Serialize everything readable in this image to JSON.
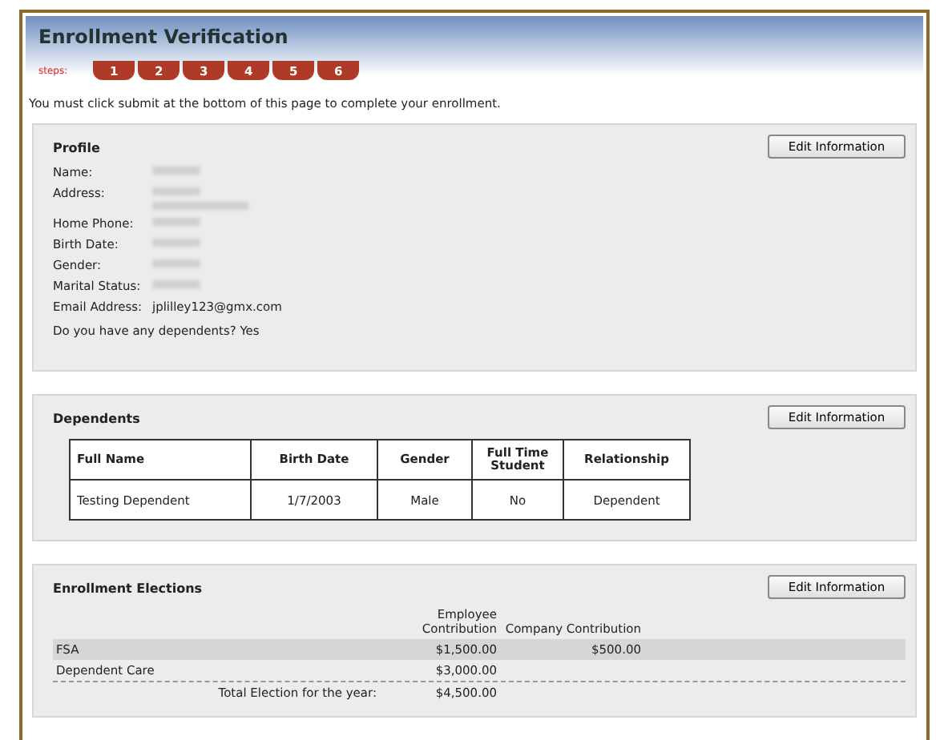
{
  "header": {
    "title": "Enrollment Verification",
    "steps_label": "steps:",
    "steps": [
      "1",
      "2",
      "3",
      "4",
      "5",
      "6"
    ],
    "instruction": "You must click submit at the bottom of this page to complete your enrollment."
  },
  "profile": {
    "title": "Profile",
    "button": "Edit Information",
    "fields": [
      {
        "label": "Name:",
        "kind": "blurred"
      },
      {
        "label": "Address:",
        "kind": "blurred_two_lines"
      },
      {
        "label": "Home Phone:",
        "kind": "blurred"
      },
      {
        "label": "Birth Date:",
        "kind": "blurred"
      },
      {
        "label": "Gender:",
        "kind": "blurred"
      },
      {
        "label": "Marital Status:",
        "kind": "blurred"
      },
      {
        "label": "Email Address:",
        "kind": "text",
        "value": "jplilley123@gmx.com"
      }
    ],
    "question": "Do you have any dependents? Yes"
  },
  "dependents": {
    "title": "Dependents",
    "button": "Edit Information",
    "columns": [
      "Full Name",
      "Birth Date",
      "Gender",
      "Full Time Student",
      "Relationship"
    ],
    "rows": [
      [
        "Testing Dependent",
        "1/7/2003",
        "Male",
        "No",
        "Dependent"
      ]
    ]
  },
  "elections": {
    "title": "Enrollment Elections",
    "button": "Edit Information",
    "employee_heading": "Employee Contribution",
    "company_heading": "Company Contribution",
    "rows": [
      {
        "name": "FSA",
        "employee": "$1,500.00",
        "company": "$500.00"
      },
      {
        "name": "Dependent Care",
        "employee": "$3,000.00"
      }
    ],
    "total_label": "Total Election for the year:",
    "total_value": "$4,500.00"
  }
}
